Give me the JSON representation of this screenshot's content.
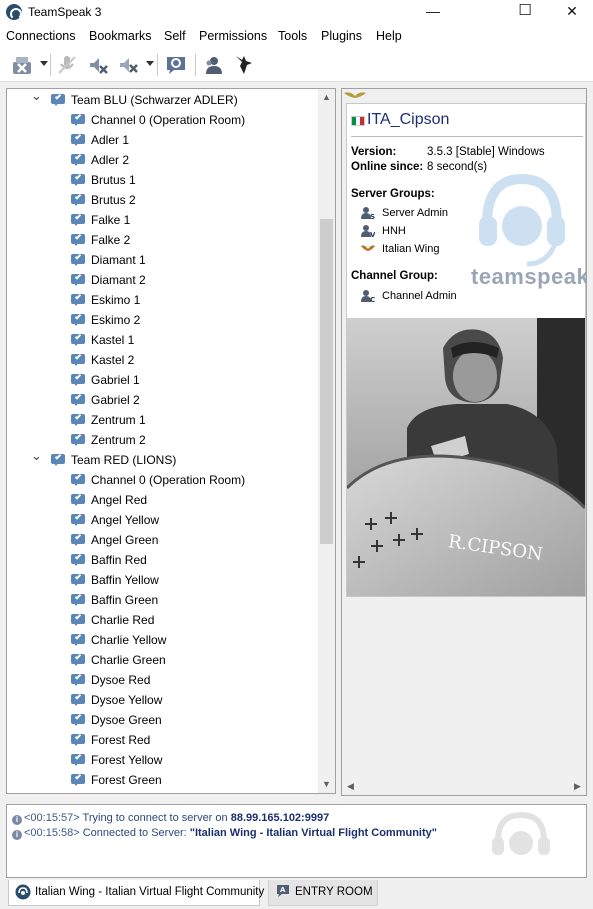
{
  "window": {
    "title": "TeamSpeak 3",
    "minimize": "—",
    "maximize": "☐",
    "close": "✕"
  },
  "menu": [
    "Connections",
    "Bookmarks",
    "Self",
    "Permissions",
    "Tools",
    "Plugins",
    "Help"
  ],
  "toolbar": {
    "icons": [
      "disconnect-icon",
      "mute-microphone-icon",
      "mute-speakers-icon",
      "away-icon",
      "chat-icon",
      "contacts-icon",
      "identity-icon"
    ]
  },
  "tree": {
    "groups": [
      {
        "name": "Team BLU (Schwarzer ADLER)",
        "channels": [
          "Channel 0 (Operation Room)",
          "Adler 1",
          "Adler 2",
          "Brutus 1",
          "Brutus 2",
          "Falke 1",
          "Falke 2",
          "Diamant 1",
          "Diamant 2",
          "Eskimo 1",
          "Eskimo 2",
          "Kastel 1",
          "Kastel 2",
          "Gabriel 1",
          "Gabriel 2",
          "Zentrum 1",
          "Zentrum 2"
        ]
      },
      {
        "name": "Team RED (LIONS)",
        "channels": [
          "Channel 0 (Operation Room)",
          "Angel Red",
          "Angel Yellow",
          "Angel Green",
          "Baffin Red",
          "Baffin Yellow",
          "Baffin Green",
          "Charlie Red",
          "Charlie Yellow",
          "Charlie Green",
          "Dysoe Red",
          "Dysoe Yellow",
          "Dysoe Green",
          "Forest Red",
          "Forest Yellow",
          "Forest Green"
        ]
      }
    ]
  },
  "client": {
    "nickname": "ITA_Cipson",
    "flag_colors": [
      "#009246",
      "#ffffff",
      "#ce2b37"
    ],
    "version_label": "Version:",
    "version_value": "3.5.3 [Stable] Windows",
    "online_label": "Online since:",
    "online_value": "8 second(s)",
    "server_groups_label": "Server Groups:",
    "server_groups": [
      {
        "name": "Server Admin",
        "icon": "server-admin-icon"
      },
      {
        "name": "HNH",
        "icon": "hnh-icon"
      },
      {
        "name": "Italian Wing",
        "icon": "italian-wing-icon"
      }
    ],
    "channel_group_label": "Channel Group:",
    "channel_group": {
      "name": "Channel Admin",
      "icon": "channel-admin-icon"
    },
    "watermark": "teamspeak",
    "avatar_caption": "R.CIPSON"
  },
  "log": [
    {
      "time": "<00:15:57>",
      "text": " Trying to connect to server on ",
      "bold": "88.99.165.102:9997"
    },
    {
      "time": "<00:15:58>",
      "text": " Connected to Server: ",
      "bold": "\"Italian Wing - Italian Virtual Flight Community\""
    }
  ],
  "tabs": [
    {
      "label": "Italian Wing - Italian Virtual Flight Community",
      "active": true
    },
    {
      "label": "ENTRY ROOM",
      "active": false
    }
  ],
  "colors": {
    "accent": "#1c2f7a",
    "channel_icon": "#5a86b8"
  }
}
